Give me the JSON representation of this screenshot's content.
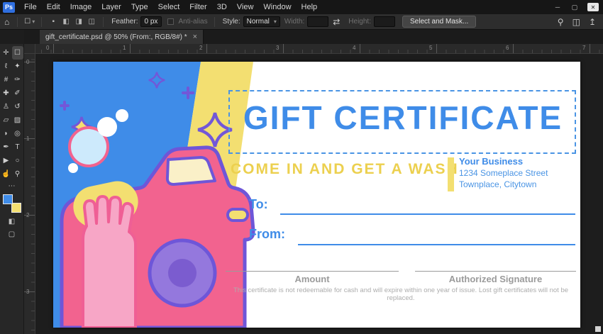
{
  "window": {
    "logo": "Ps",
    "menus": [
      "File",
      "Edit",
      "Image",
      "Layer",
      "Type",
      "Select",
      "Filter",
      "3D",
      "View",
      "Window",
      "Help"
    ],
    "controls": {
      "minimize": "─",
      "maximize": "▢",
      "close": "✕"
    }
  },
  "options_bar": {
    "home_icon": "⌂",
    "tool_icon": "☐",
    "tool_caret": "▾",
    "selection_modes": [
      "▪",
      "◧",
      "◨",
      "◫"
    ],
    "feather_label": "Feather:",
    "feather_value": "0 px",
    "anti_alias_label": "Anti-alias",
    "style_label": "Style:",
    "style_value": "Normal",
    "style_caret": "▾",
    "width_label": "Width:",
    "width_value": "",
    "swap_icon": "⇄",
    "height_label": "Height:",
    "height_value": "",
    "select_and_mask_label": "Select and Mask...",
    "search_icon": "⚲",
    "layout_icon": "◫",
    "share_icon": "↥"
  },
  "tab": {
    "title": "gift_certificate.psd @ 50% (From:, RGB/8#) *",
    "close_icon": "×"
  },
  "rulers": {
    "horizontal": [
      "0",
      "1",
      "2",
      "3",
      "4",
      "5",
      "6",
      "7"
    ],
    "vertical": [
      "0",
      "1",
      "2",
      "3"
    ]
  },
  "toolbar": {
    "tools": [
      {
        "name": "move-tool",
        "glyph": "✛"
      },
      {
        "name": "rectangular-marquee-tool",
        "glyph": "☐",
        "selected": true
      },
      {
        "name": "lasso-tool",
        "glyph": "ℓ"
      },
      {
        "name": "quick-selection-tool",
        "glyph": "✦"
      },
      {
        "name": "crop-tool",
        "glyph": "#"
      },
      {
        "name": "eyedropper-tool",
        "glyph": "✑"
      },
      {
        "name": "spot-healing-brush-tool",
        "glyph": "✚"
      },
      {
        "name": "brush-tool",
        "glyph": "✐"
      },
      {
        "name": "clone-stamp-tool",
        "glyph": "♙"
      },
      {
        "name": "history-brush-tool",
        "glyph": "↺"
      },
      {
        "name": "eraser-tool",
        "glyph": "▱"
      },
      {
        "name": "gradient-tool",
        "glyph": "▨"
      },
      {
        "name": "blur-tool",
        "glyph": "◗"
      },
      {
        "name": "dodge-tool",
        "glyph": "◎"
      },
      {
        "name": "pen-tool",
        "glyph": "✒"
      },
      {
        "name": "type-tool",
        "glyph": "T"
      },
      {
        "name": "path-selection-tool",
        "glyph": "▶"
      },
      {
        "name": "ellipse-tool",
        "glyph": "○"
      },
      {
        "name": "hand-tool",
        "glyph": "☝"
      },
      {
        "name": "zoom-tool",
        "glyph": "⚲"
      }
    ],
    "more_icon": "⋯",
    "foreground_color": "#3f8ce8",
    "background_color": "#f3df71",
    "quick_mask_icon": "◧",
    "screen_mode_icon": "▢"
  },
  "certificate": {
    "title": "GIFT CERTIFICATE",
    "subtitle": "COME IN AND GET A WASH",
    "business_name": "Your Business",
    "address_line1": "1234 Someplace Street",
    "address_line2": "Townplace, Citytown",
    "to_label": "To:",
    "from_label": "From:",
    "amount_label": "Amount",
    "signature_label": "Authorized Signature",
    "disclaimer": "This certificate is not redeemable for cash and will expire within one year of issue. Lost gift certificates will not be replaced.",
    "colors": {
      "blue": "#3f8ce8",
      "yellow": "#f3df71",
      "pink": "#f2638f",
      "purple": "#6e56d8",
      "hand_pink": "#f7a6c6",
      "bubble_blue": "#cdeafc",
      "grey": "#9b9b9b"
    }
  }
}
